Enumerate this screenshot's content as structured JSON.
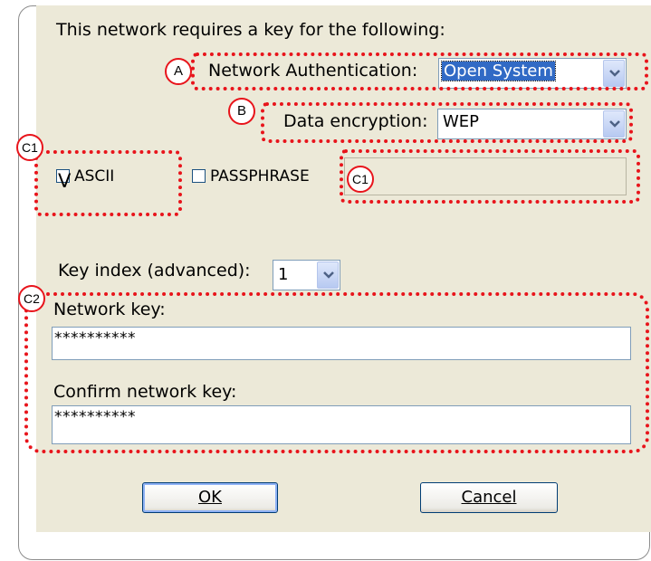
{
  "header_text": "This network requires a key for the following:",
  "network_authentication": {
    "label": "Network Authentication:",
    "value": "Open System"
  },
  "data_encryption": {
    "label": "Data encryption:",
    "value": "WEP"
  },
  "ascii": {
    "label": "ASCII",
    "mark": "V"
  },
  "passphrase": {
    "label": "PASSPHRASE"
  },
  "key_index": {
    "label": "Key index (advanced):",
    "value": "1"
  },
  "network_key": {
    "label": "Network key:",
    "value": "**********"
  },
  "confirm_key": {
    "label": "Confirm network key:",
    "value": "**********"
  },
  "buttons": {
    "ok": "OK",
    "cancel": "Cancel"
  },
  "annotations": {
    "a": "A",
    "b": "B",
    "c1_left": "C1",
    "c1_right": "C1",
    "c2": "C2"
  },
  "colors": {
    "annotation": "#e8141b",
    "dialog_bg": "#ece9d8",
    "selection": "#316ac5"
  }
}
